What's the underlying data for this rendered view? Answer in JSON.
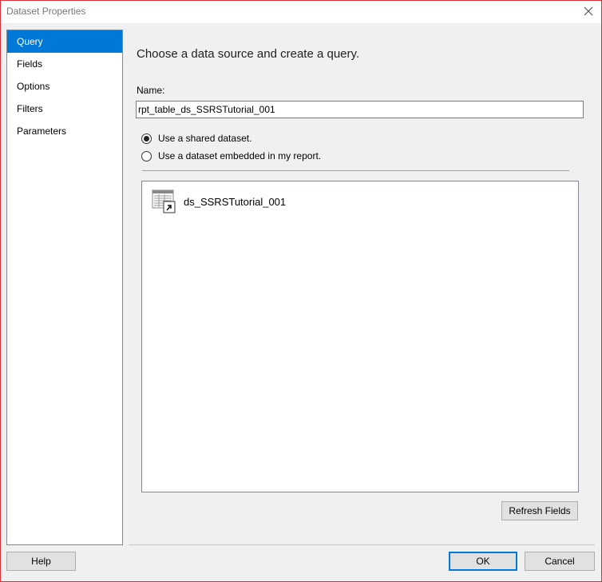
{
  "window": {
    "title": "Dataset Properties"
  },
  "sidebar": {
    "items": [
      {
        "label": "Query",
        "selected": true
      },
      {
        "label": "Fields"
      },
      {
        "label": "Options"
      },
      {
        "label": "Filters"
      },
      {
        "label": "Parameters"
      }
    ]
  },
  "main": {
    "heading": "Choose a data source and create a query.",
    "name_label": "Name:",
    "name_value": "rpt_table_ds_SSRSTutorial_001",
    "radio_shared": "Use a shared dataset.",
    "radio_embedded": "Use a dataset embedded in my report.",
    "selected_radio": "shared",
    "datasets": [
      {
        "label": "ds_SSRSTutorial_001",
        "icon": "shared-dataset-icon"
      }
    ],
    "refresh_button": "Refresh Fields"
  },
  "footer": {
    "help_button": "Help",
    "ok_button": "OK",
    "cancel_button": "Cancel"
  },
  "colors": {
    "selection": "#0078d7",
    "window_border": "#d9323a"
  }
}
